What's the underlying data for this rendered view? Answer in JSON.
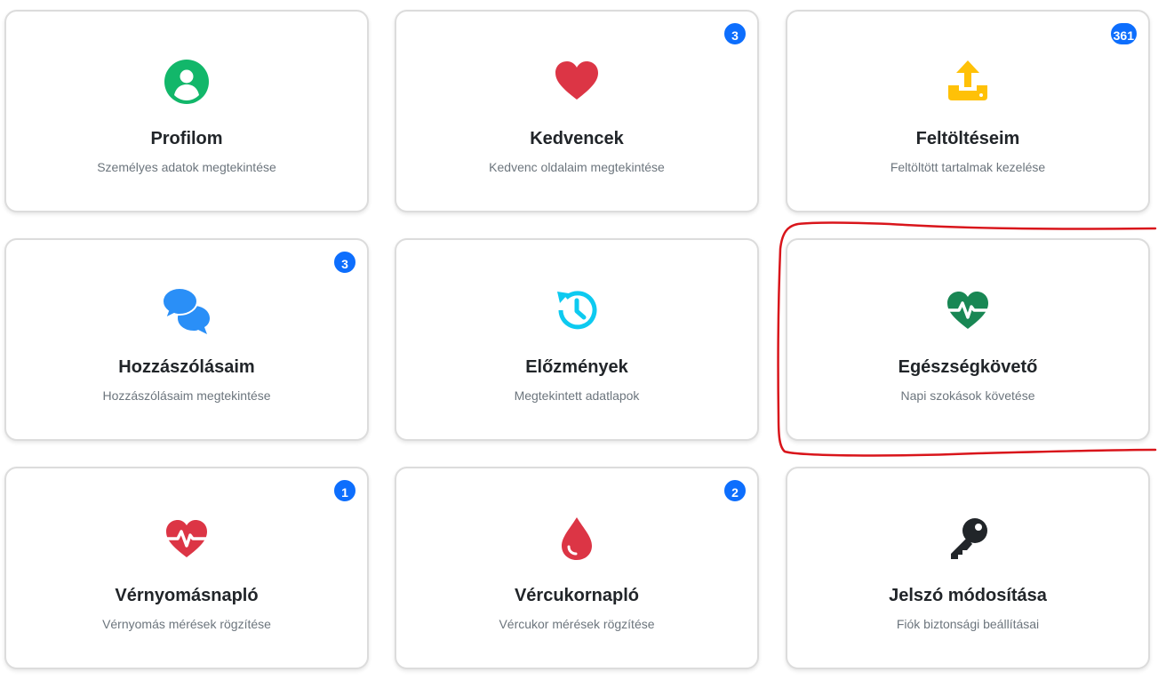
{
  "cards": [
    {
      "title": "Profilom",
      "desc": "Személyes adatok megtekintése",
      "icon": "user-circle-icon",
      "color": "#12b76a"
    },
    {
      "title": "Kedvencek",
      "desc": "Kedvenc oldalaim megtekintése",
      "icon": "heart-icon",
      "color": "#dc3545",
      "badge": "3"
    },
    {
      "title": "Feltöltéseim",
      "desc": "Feltöltött tartalmak kezelése",
      "icon": "upload-icon",
      "color": "#ffc107",
      "badge": "361"
    },
    {
      "title": "Hozzászólásaim",
      "desc": "Hozzászólásaim megtekintése",
      "icon": "comments-icon",
      "color": "#2a8ff7",
      "badge": "3"
    },
    {
      "title": "Előzmények",
      "desc": "Megtekintett adatlapok",
      "icon": "history-icon",
      "color": "#0dcaf0"
    },
    {
      "title": "Egészségkövető",
      "desc": "Napi szokások követése",
      "icon": "heart-pulse-icon",
      "color": "#198754"
    },
    {
      "title": "Vérnyomásnapló",
      "desc": "Vérnyomás mérések rögzítése",
      "icon": "heart-pulse-icon",
      "color": "#dc3545",
      "badge": "1"
    },
    {
      "title": "Vércukornapló",
      "desc": "Vércukor mérések rögzítése",
      "icon": "blood-drop-icon",
      "color": "#dc3545",
      "badge": "2"
    },
    {
      "title": "Jelszó módosítása",
      "desc": "Fiók biztonsági beállításai",
      "icon": "key-icon",
      "color": "#212529"
    }
  ],
  "accent_color": "#0d6efd",
  "annotation_color": "#d9151b"
}
